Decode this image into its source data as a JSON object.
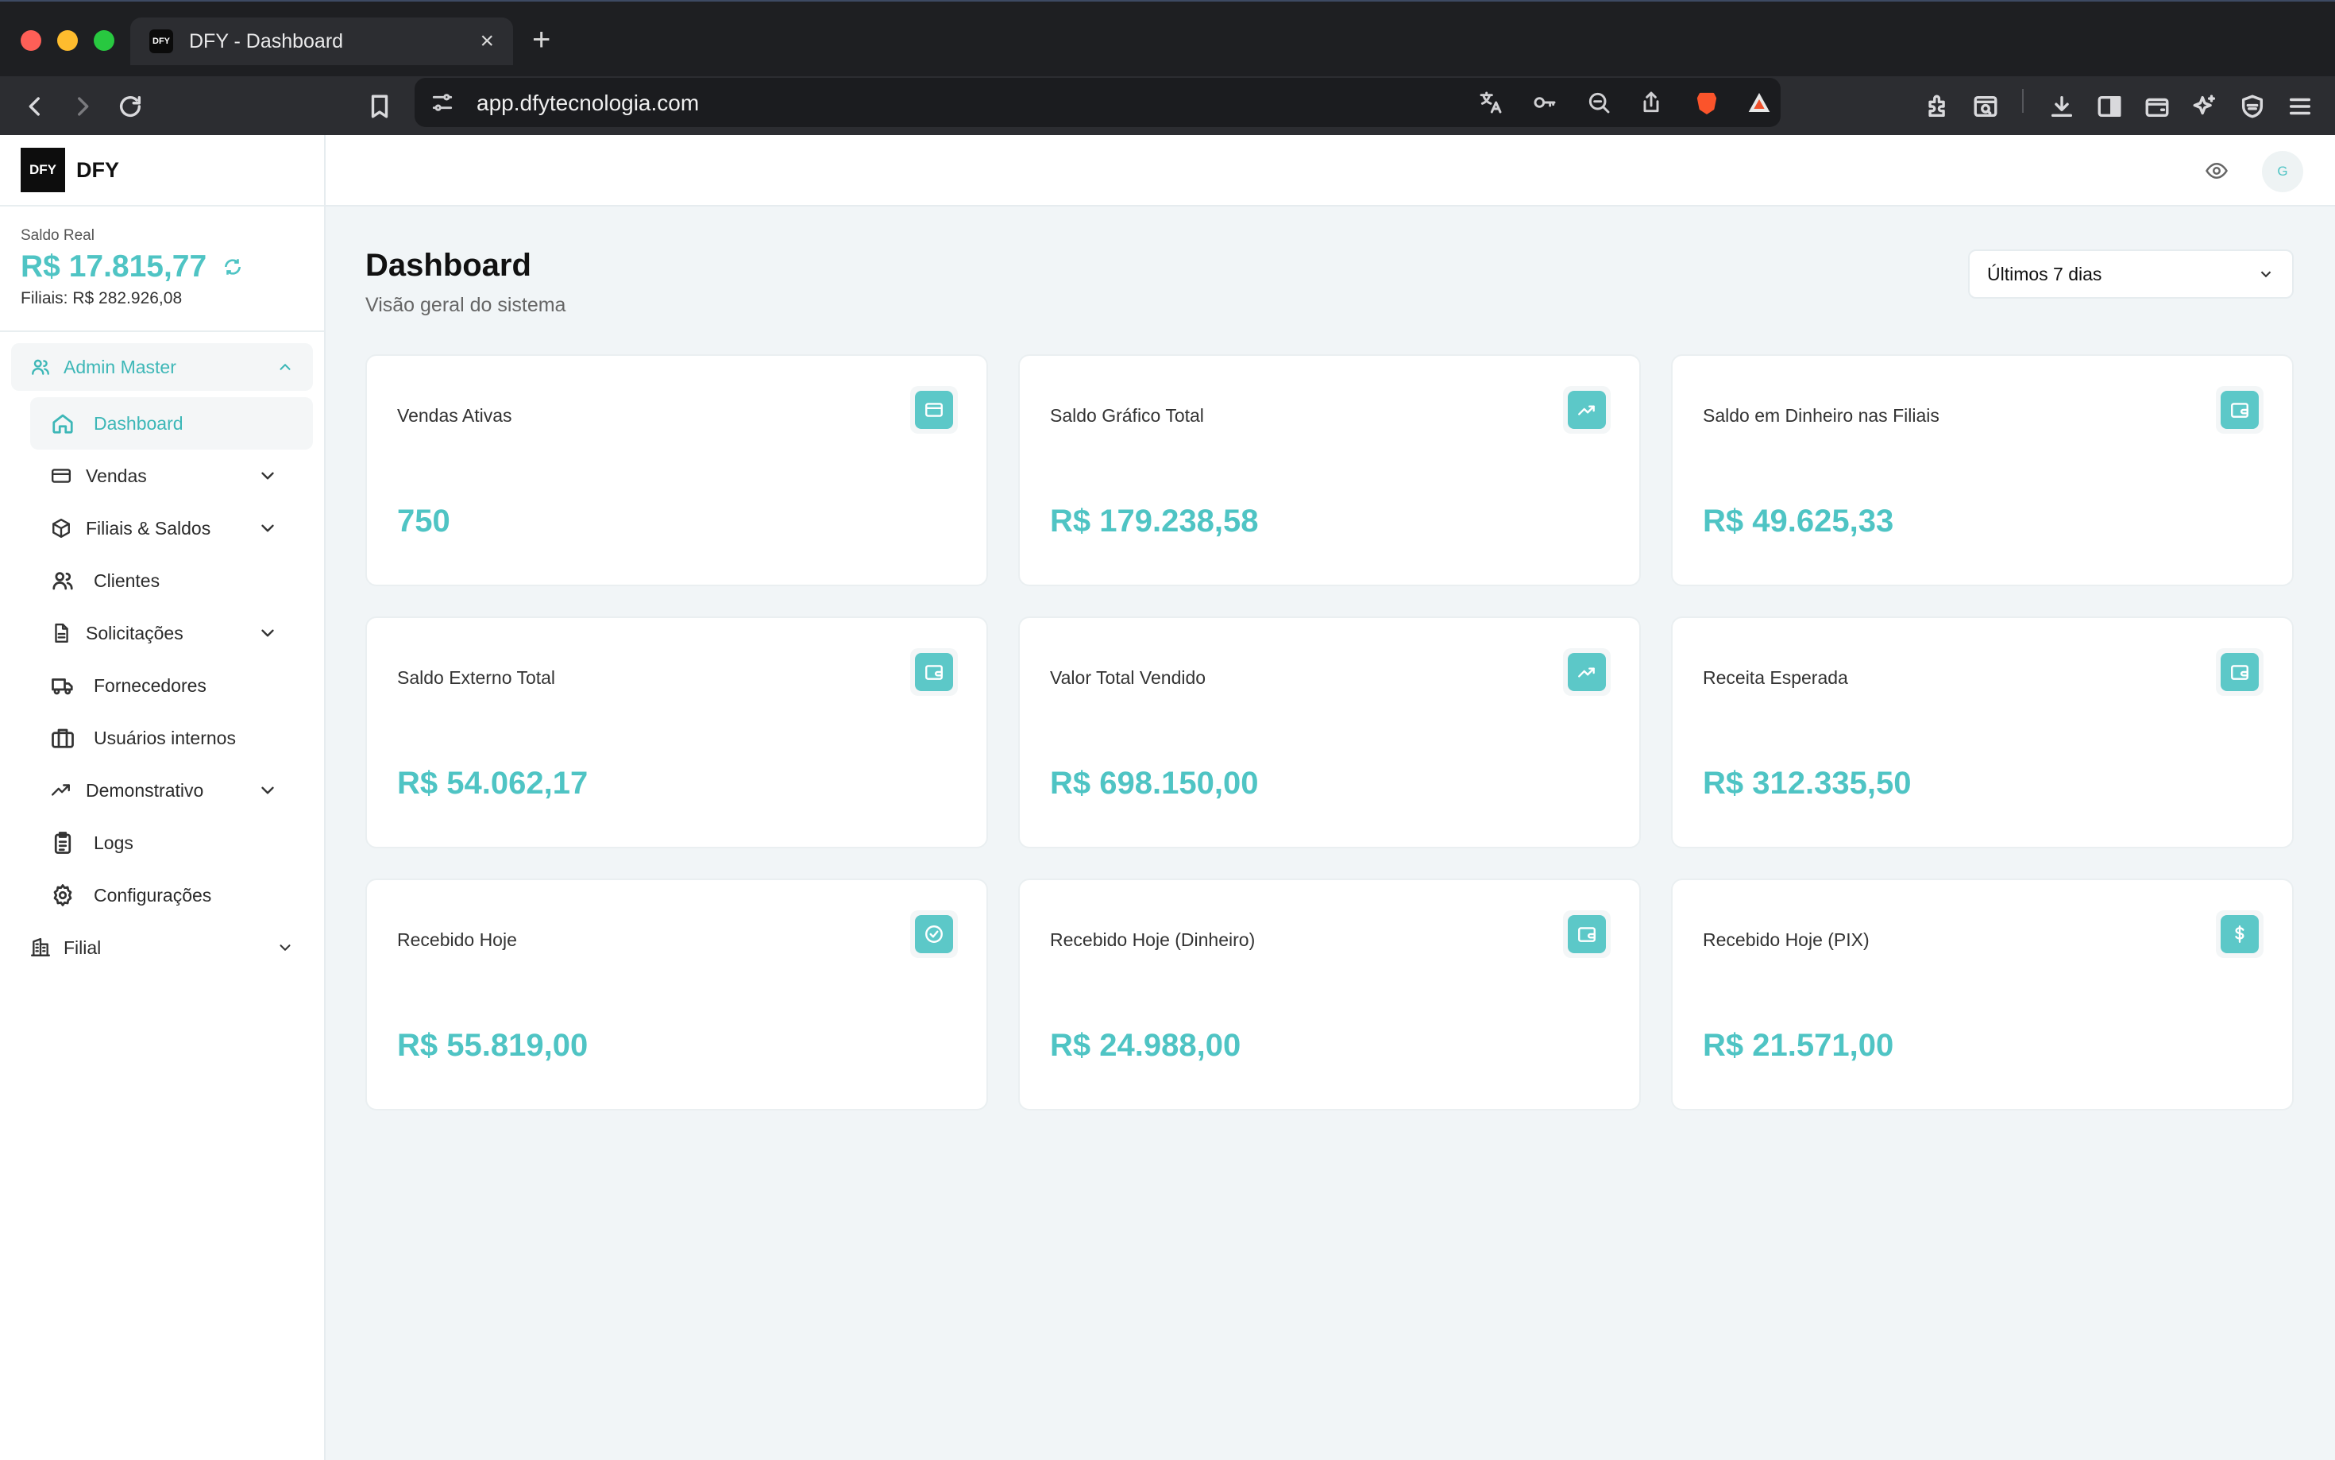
{
  "browser": {
    "tab_title": "DFY - Dashboard",
    "tab_favicon_text": "DFY",
    "url": "app.dfytecnologia.com"
  },
  "brand": {
    "logo_text": "DFY",
    "name": "DFY"
  },
  "balance": {
    "label": "Saldo Real",
    "value": "R$ 17.815,77",
    "branches": "Filiais: R$ 282.926,08"
  },
  "nav": {
    "group_label": "Admin Master",
    "items": [
      {
        "label": "Dashboard",
        "icon": "home-icon",
        "active": true
      },
      {
        "label": "Vendas",
        "icon": "card-icon",
        "expandable": true
      },
      {
        "label": "Filiais & Saldos",
        "icon": "box-icon",
        "expandable": true
      },
      {
        "label": "Clientes",
        "icon": "users-icon"
      },
      {
        "label": "Solicitações",
        "icon": "document-icon",
        "expandable": true
      },
      {
        "label": "Fornecedores",
        "icon": "truck-icon"
      },
      {
        "label": "Usuários internos",
        "icon": "briefcase-icon"
      },
      {
        "label": "Demonstrativo",
        "icon": "trending-up-icon",
        "expandable": true
      },
      {
        "label": "Logs",
        "icon": "clipboard-icon"
      },
      {
        "label": "Configurações",
        "icon": "gear-icon"
      }
    ],
    "root_label": "Filial"
  },
  "topbar": {
    "avatar_initial": "G"
  },
  "header": {
    "title": "Dashboard",
    "subtitle": "Visão geral do sistema",
    "period": "Últimos 7 dias"
  },
  "cards": [
    {
      "label": "Vendas Ativas",
      "value": "750",
      "icon": "credit-card-icon"
    },
    {
      "label": "Saldo Gráfico Total",
      "value": "R$ 179.238,58",
      "icon": "trending-up-icon"
    },
    {
      "label": "Saldo em Dinheiro nas Filiais",
      "value": "R$ 49.625,33",
      "icon": "wallet-icon"
    },
    {
      "label": "Saldo Externo Total",
      "value": "R$ 54.062,17",
      "icon": "wallet-icon"
    },
    {
      "label": "Valor Total Vendido",
      "value": "R$ 698.150,00",
      "icon": "trending-up-icon"
    },
    {
      "label": "Receita Esperada",
      "value": "R$ 312.335,50",
      "icon": "wallet-icon"
    },
    {
      "label": "Recebido Hoje",
      "value": "R$ 55.819,00",
      "icon": "check-circle-icon"
    },
    {
      "label": "Recebido Hoje (Dinheiro)",
      "value": "R$ 24.988,00",
      "icon": "wallet-icon"
    },
    {
      "label": "Recebido Hoje (PIX)",
      "value": "R$ 21.571,00",
      "icon": "dollar-icon"
    }
  ],
  "colors": {
    "accent": "#4fc4c4",
    "background": "#f1f5f7",
    "chrome": "#2c2d31"
  }
}
